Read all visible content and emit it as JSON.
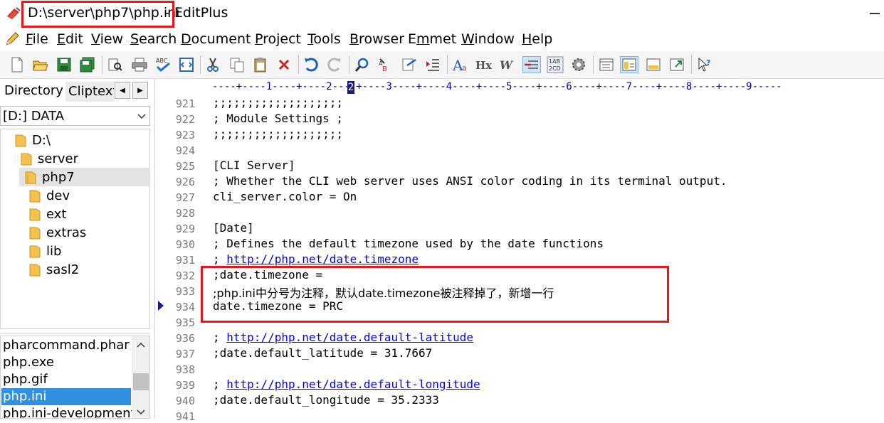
{
  "window": {
    "file_path": "D:\\server\\php7\\php.ini",
    "app_suffix": " - EditPlus"
  },
  "menu": [
    "File",
    "Edit",
    "View",
    "Search",
    "Document",
    "Project",
    "Tools",
    "Browser",
    "Emmet",
    "Window",
    "Help"
  ],
  "menu_underline": [
    "F",
    "E",
    "V",
    "S",
    "D",
    "P",
    "T",
    "B",
    "m",
    "W",
    "H"
  ],
  "toolbar_icons": [
    "new-file-icon",
    "open-file-icon",
    "save-icon",
    "save-all-icon",
    "print-preview-icon",
    "print-icon",
    "spell-check-icon",
    "browser-preview-icon",
    "cut-icon",
    "copy-icon",
    "paste-icon",
    "delete-icon",
    "undo-icon",
    "redo-icon",
    "find-icon",
    "replace-icon",
    "go-to-icon",
    "indent-icon",
    "font-icon",
    "hex-icon",
    "word-wrap-icon",
    "line-number-icon",
    "ruler-icon",
    "settings-icon",
    "directory-window-icon",
    "cliptext-window-icon",
    "output-window-icon",
    "full-screen-icon",
    "help-icon"
  ],
  "left_panel": {
    "tab_directory": "Directory",
    "tab_cliptext": "Cliptext",
    "drive": "[D:] DATA",
    "tree": [
      "D:\\",
      "server",
      "php7",
      "dev",
      "ext",
      "extras",
      "lib",
      "sasl2"
    ],
    "files": [
      "pharcommand.phar",
      "php.exe",
      "php.gif",
      "php.ini",
      "php.ini-development"
    ],
    "selected_file": "php.ini"
  },
  "editor": {
    "ruler": "----+----1----+----2----+----3----+----4----+----5----+----6----+----7----+----8----+----9-----",
    "lines": [
      {
        "n": "921",
        "t": ";;;;;;;;;;;;;;;;;;;"
      },
      {
        "n": "922",
        "t": "; Module Settings ;"
      },
      {
        "n": "923",
        "t": ";;;;;;;;;;;;;;;;;;;"
      },
      {
        "n": "924",
        "t": ""
      },
      {
        "n": "925",
        "t": "[CLI Server]"
      },
      {
        "n": "926",
        "t": "; Whether the CLI web server uses ANSI color coding in its terminal output."
      },
      {
        "n": "927",
        "t": "cli_server.color = On"
      },
      {
        "n": "928",
        "t": ""
      },
      {
        "n": "929",
        "t": "[Date]"
      },
      {
        "n": "930",
        "t": "; Defines the default timezone used by the date functions"
      },
      {
        "n": "931",
        "t": "; ",
        "link": "http://php.net/date.timezone"
      },
      {
        "n": "932",
        "t": ";date.timezone ="
      },
      {
        "n": "933",
        "t": ";php.ini中分号为注释，默认date.timezone被注释掉了，新增一行"
      },
      {
        "n": "934",
        "t": "date.timezone = PRC"
      },
      {
        "n": "935",
        "t": ""
      },
      {
        "n": "936",
        "t": "; ",
        "link": "http://php.net/date.default-latitude"
      },
      {
        "n": "937",
        "t": ";date.default_latitude = 31.7667"
      },
      {
        "n": "938",
        "t": ""
      },
      {
        "n": "939",
        "t": "; ",
        "link": "http://php.net/date.default-longitude"
      },
      {
        "n": "940",
        "t": ";date.default_longitude = 35.2333"
      },
      {
        "n": "941",
        "t": ""
      }
    ]
  },
  "colors": {
    "highlight_box": "#e8161b",
    "selection": "#3290e0",
    "link": "#0000ff",
    "ruler": "#0000aa"
  }
}
